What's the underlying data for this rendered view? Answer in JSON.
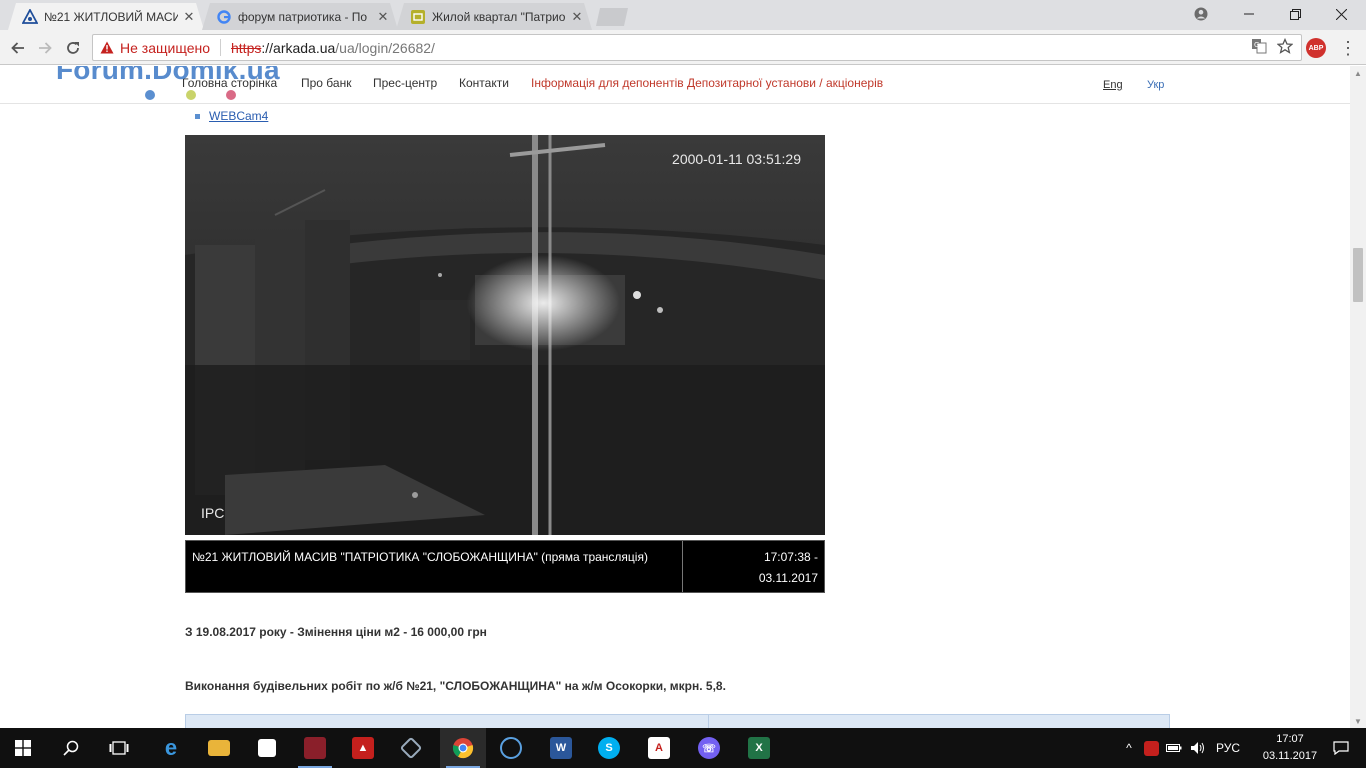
{
  "browser": {
    "tabs": [
      {
        "title": "№21 ЖИТЛОВИЙ МАСИ",
        "favicon": "arkada-icon",
        "active": true
      },
      {
        "title": "форум патриотика - По",
        "favicon": "google-icon",
        "active": false
      },
      {
        "title": "Жилой квартал \"Патрио",
        "favicon": "domik-icon",
        "active": false
      }
    ],
    "security_label": "Не защищено",
    "url_scheme": "https",
    "url_host": "://arkada.ua",
    "url_path": "/ua/login/26682/",
    "abp_label": "ABP"
  },
  "watermark": {
    "text": "Forum.Domik.ua",
    "dot_colors": [
      "#5b8fd0",
      "#c9d36a",
      "#d96a86"
    ]
  },
  "site_nav": {
    "items": [
      "Головна сторінка",
      "Про банк",
      "Прес-центр",
      "Контакти"
    ],
    "highlight": "Інформація для депонентів Депозитарної установи / акціонерів",
    "lang_en": "Eng",
    "lang_uk": "Укр"
  },
  "cam_link": "WEBCam4",
  "camera": {
    "timestamp": "2000-01-11 03:51:29",
    "label": "IPC"
  },
  "caption": {
    "title": "№21 ЖИТЛОВИЙ МАСИВ \"ПАТРІОТИКА \"СЛОБОЖАНЩИНА\" (пряма трансляція)",
    "time_line1": "17:07:38 -",
    "time_line2": "03.11.2017"
  },
  "notice": "З 19.08.2017 року - Змінення ціни м2 - 16 000,00 грн",
  "works_heading": "Виконання будівельних робіт по ж/б №21, \"СЛОБОЖАНЩИНА\" на ж/м Осокорки, мкрн. 5,8.",
  "taskbar": {
    "apps": [
      "edge",
      "explorer",
      "store",
      "media",
      "acrobat",
      "virtualbox",
      "chrome",
      "connect",
      "word",
      "skype",
      "pdf",
      "viber",
      "excel"
    ],
    "language": "РУС",
    "time": "17:07",
    "date": "03.11.2017"
  }
}
